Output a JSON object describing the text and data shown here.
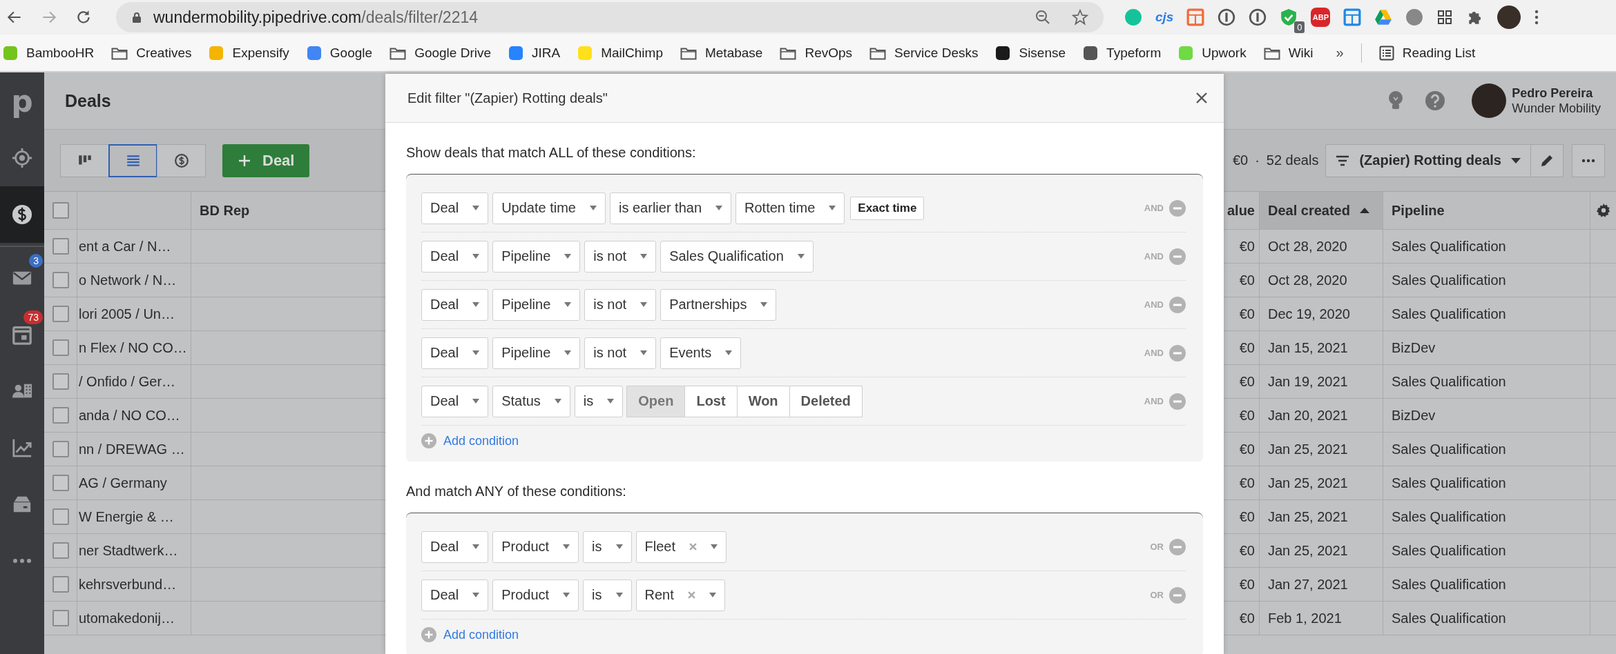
{
  "browser": {
    "address": {
      "host": "wundermobility.pipedrive.com",
      "path": "/deals/filter/2214"
    },
    "extensions": [
      {
        "kind": "dot",
        "color": "#15c39a"
      },
      {
        "kind": "label",
        "text": "cjs",
        "color": "#2b7de9"
      },
      {
        "kind": "square",
        "color": "#f26b3a"
      },
      {
        "kind": "ring",
        "color": "#555555"
      },
      {
        "kind": "ring",
        "color": "#555555"
      },
      {
        "kind": "shield",
        "color": "#2bb24c",
        "badge": "0"
      },
      {
        "kind": "octagon",
        "text": "ABP",
        "color": "#d9252a"
      },
      {
        "kind": "square",
        "color": "#1e88e5"
      },
      {
        "kind": "triangle",
        "color": "#0f9d58"
      },
      {
        "kind": "dot",
        "color": "#888888"
      },
      {
        "kind": "grid"
      },
      {
        "kind": "puzzle"
      }
    ],
    "bookmarks": [
      {
        "label": "BambooHR",
        "kind": "site",
        "color": "#73c41d"
      },
      {
        "label": "Creatives",
        "kind": "folder"
      },
      {
        "label": "Expensify",
        "kind": "site",
        "color": "#f5b400"
      },
      {
        "label": "Google",
        "kind": "site",
        "color": "#4285f4"
      },
      {
        "label": "Google Drive",
        "kind": "folder"
      },
      {
        "label": "JIRA",
        "kind": "site",
        "color": "#2684ff"
      },
      {
        "label": "MailChimp",
        "kind": "site",
        "color": "#ffe01b"
      },
      {
        "label": "Metabase",
        "kind": "folder"
      },
      {
        "label": "RevOps",
        "kind": "folder"
      },
      {
        "label": "Service Desks",
        "kind": "folder"
      },
      {
        "label": "Sisense",
        "kind": "site",
        "color": "#1a1a1a"
      },
      {
        "label": "Typeform",
        "kind": "site",
        "color": "#555555"
      },
      {
        "label": "Upwork",
        "kind": "site",
        "color": "#6fda44"
      },
      {
        "label": "Wiki",
        "kind": "folder"
      }
    ],
    "overflow": "»",
    "reading_list": "Reading List"
  },
  "sidebar": {
    "logo": "p",
    "items": [
      {
        "selected": false
      },
      {
        "selected": true
      },
      {
        "selected": false,
        "badge": "3",
        "color": "#3b6fc4"
      },
      {
        "selected": false,
        "badge": "73",
        "color": "#c62f2f"
      },
      {
        "selected": false
      },
      {
        "selected": false
      },
      {
        "selected": false
      },
      {
        "selected": false
      }
    ]
  },
  "header": {
    "title": "Deals",
    "user": {
      "name": "Pedro Pereira",
      "company": "Wunder Mobility"
    }
  },
  "toolbar": {
    "views": [
      {
        "selected": false
      },
      {
        "selected": true
      },
      {
        "selected": false
      }
    ],
    "add_label": "Deal",
    "summary": {
      "value": "€0",
      "separator": "·",
      "count": "52 deals"
    },
    "filter_label": "(Zapier) Rotting deals"
  },
  "table": {
    "select_all": {
      "checked": false
    },
    "columns": [
      {
        "label": "BD Rep",
        "sorted": false
      },
      {
        "label": "alue",
        "sorted": false
      },
      {
        "label": "Deal created",
        "sorted": true
      },
      {
        "label": "Pipeline",
        "sorted": false
      }
    ],
    "rows": [
      {
        "checked": false,
        "title": "ent a Car / N…",
        "value": "€0",
        "created": "Oct 28, 2020",
        "pipeline": "Sales Qualification"
      },
      {
        "checked": false,
        "title": "o Network / N…",
        "value": "€0",
        "created": "Oct 28, 2020",
        "pipeline": "Sales Qualification"
      },
      {
        "checked": false,
        "title": "lori 2005 / Un…",
        "value": "€0",
        "created": "Dec 19, 2020",
        "pipeline": "Sales Qualification"
      },
      {
        "checked": false,
        "title": "n Flex / NO CO…",
        "value": "€0",
        "created": "Jan 15, 2021",
        "pipeline": "BizDev"
      },
      {
        "checked": false,
        "title": "/ Onfido / Ger…",
        "value": "€0",
        "created": "Jan 19, 2021",
        "pipeline": "Sales Qualification"
      },
      {
        "checked": false,
        "title": "anda / NO CO…",
        "value": "€0",
        "created": "Jan 20, 2021",
        "pipeline": "BizDev"
      },
      {
        "checked": false,
        "title": "nn / DREWAG …",
        "value": "€0",
        "created": "Jan 25, 2021",
        "pipeline": "Sales Qualification"
      },
      {
        "checked": false,
        "title": "AG / Germany",
        "value": "€0",
        "created": "Jan 25, 2021",
        "pipeline": "Sales Qualification"
      },
      {
        "checked": false,
        "title": "W Energie & …",
        "value": "€0",
        "created": "Jan 25, 2021",
        "pipeline": "Sales Qualification"
      },
      {
        "checked": false,
        "title": "ner Stadtwerk…",
        "value": "€0",
        "created": "Jan 25, 2021",
        "pipeline": "Sales Qualification"
      },
      {
        "checked": false,
        "title": "kehrsverbund…",
        "value": "€0",
        "created": "Jan 27, 2021",
        "pipeline": "Sales Qualification"
      },
      {
        "checked": false,
        "title": "utomakedonij…",
        "value": "€0",
        "created": "Feb 1, 2021",
        "pipeline": "Sales Qualification"
      }
    ]
  },
  "modal": {
    "title": "Edit filter \"(Zapier) Rotting deals\"",
    "groups": [
      {
        "heading": "Show deals that match ALL of these conditions:",
        "add_label": "Add condition",
        "conditions": [
          {
            "joiner": "AND",
            "fields": [
              {
                "kind": "select",
                "value": "Deal"
              },
              {
                "kind": "select",
                "value": "Update time"
              },
              {
                "kind": "select",
                "value": "is earlier than"
              },
              {
                "kind": "select",
                "value": "Rotten time"
              },
              {
                "kind": "button",
                "value": "Exact time"
              }
            ]
          },
          {
            "joiner": "AND",
            "fields": [
              {
                "kind": "select",
                "value": "Deal"
              },
              {
                "kind": "select",
                "value": "Pipeline"
              },
              {
                "kind": "select",
                "value": "is not"
              },
              {
                "kind": "select",
                "value": "Sales Qualification"
              }
            ]
          },
          {
            "joiner": "AND",
            "fields": [
              {
                "kind": "select",
                "value": "Deal"
              },
              {
                "kind": "select",
                "value": "Pipeline"
              },
              {
                "kind": "select",
                "value": "is not"
              },
              {
                "kind": "select",
                "value": "Partnerships"
              }
            ]
          },
          {
            "joiner": "AND",
            "fields": [
              {
                "kind": "select",
                "value": "Deal"
              },
              {
                "kind": "select",
                "value": "Pipeline"
              },
              {
                "kind": "select",
                "value": "is not"
              },
              {
                "kind": "select",
                "value": "Events"
              }
            ]
          },
          {
            "joiner": "AND",
            "fields": [
              {
                "kind": "select",
                "value": "Deal"
              },
              {
                "kind": "select",
                "value": "Status"
              },
              {
                "kind": "select",
                "value": "is"
              },
              {
                "kind": "segmented",
                "options": [
                  {
                    "label": "Open",
                    "selected": true
                  },
                  {
                    "label": "Lost",
                    "selected": false
                  },
                  {
                    "label": "Won",
                    "selected": false
                  },
                  {
                    "label": "Deleted",
                    "selected": false
                  }
                ]
              }
            ]
          }
        ]
      },
      {
        "heading": "And match ANY of these conditions:",
        "add_label": "Add condition",
        "conditions": [
          {
            "joiner": "OR",
            "fields": [
              {
                "kind": "select",
                "value": "Deal"
              },
              {
                "kind": "select",
                "value": "Product"
              },
              {
                "kind": "select",
                "value": "is"
              },
              {
                "kind": "tag_select",
                "value": "Fleet"
              }
            ]
          },
          {
            "joiner": "OR",
            "fields": [
              {
                "kind": "select",
                "value": "Deal"
              },
              {
                "kind": "select",
                "value": "Product"
              },
              {
                "kind": "select",
                "value": "is"
              },
              {
                "kind": "tag_select",
                "value": "Rent"
              }
            ]
          }
        ]
      }
    ]
  }
}
